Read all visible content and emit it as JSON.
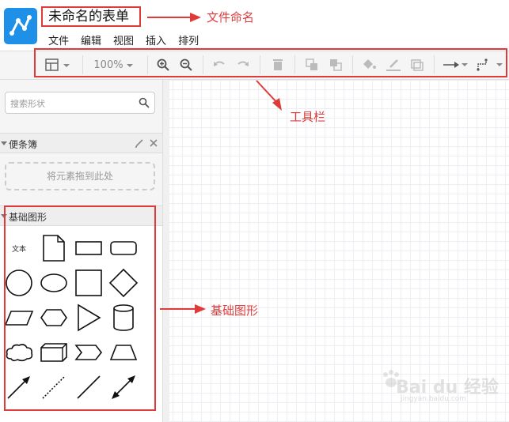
{
  "document": {
    "title": "未命名的表单"
  },
  "menu": [
    "文件",
    "编辑",
    "视图",
    "插入",
    "排列"
  ],
  "toolbar": {
    "zoom": "100%"
  },
  "sidebar": {
    "search_placeholder": "搜索形状",
    "scratchpad_title": "便条簿",
    "dropzone_text": "将元素拖到此处",
    "basic_shapes_title": "基础图形",
    "text_shape_label": "文本"
  },
  "annotations": {
    "filename": "文件命名",
    "toolbar": "工具栏",
    "basic_shapes": "基础图形"
  },
  "watermark": {
    "main": "Bai du 经验",
    "sub": "jingyan.baidu.com"
  },
  "colors": {
    "accent": "#e03b3b",
    "logo": "#1e90e8"
  }
}
